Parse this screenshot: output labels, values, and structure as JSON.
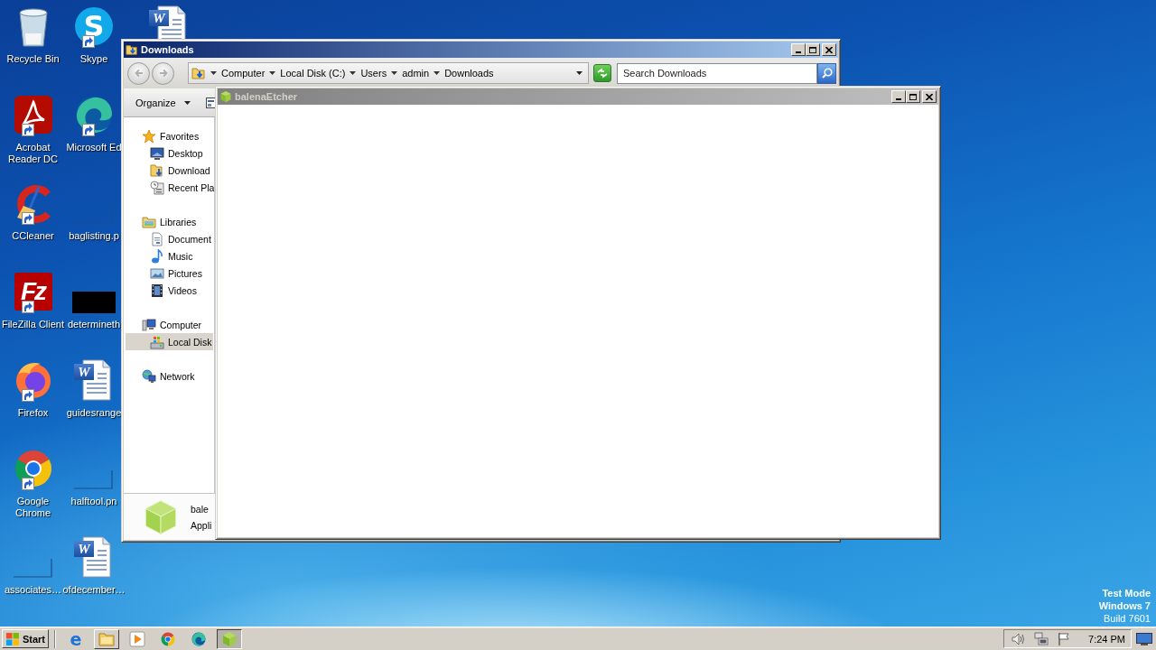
{
  "desktop": {
    "icons": [
      {
        "kind": "recycle-bin",
        "label": "Recycle Bin",
        "shortcut": false
      },
      {
        "kind": "acrobat",
        "label": "Acrobat Reader DC",
        "shortcut": true
      },
      {
        "kind": "ccleaner",
        "label": "CCleaner",
        "shortcut": true
      },
      {
        "kind": "filezilla",
        "label": "FileZilla Client",
        "shortcut": true,
        "glyph": "Fz"
      },
      {
        "kind": "firefox",
        "label": "Firefox",
        "shortcut": true
      },
      {
        "kind": "chrome",
        "label": "Google Chrome",
        "shortcut": true
      },
      {
        "kind": "thumbnail",
        "label": "associates…",
        "shortcut": false
      },
      {
        "kind": "skype",
        "label": "Skype",
        "shortcut": true,
        "glyph": "S"
      },
      {
        "kind": "edge",
        "label": "Microsoft Ed",
        "shortcut": true
      },
      {
        "kind": "thumbnail",
        "label": "baglisting.p",
        "shortcut": false
      },
      {
        "kind": "dark-thumbnail",
        "label": "determineth",
        "shortcut": false
      },
      {
        "kind": "word",
        "label": "guidesrange",
        "shortcut": false,
        "glyph": "W"
      },
      {
        "kind": "thumbnail",
        "label": "halftool.pn",
        "shortcut": false
      },
      {
        "kind": "word",
        "label": "ofdecember…",
        "shortcut": false,
        "glyph": "W"
      },
      {
        "kind": "word",
        "shortcut": false,
        "glyph": "W"
      }
    ]
  },
  "explorer": {
    "title": "Downloads",
    "crumbs": [
      "Computer",
      "Local Disk (C:)",
      "Users",
      "admin",
      "Downloads"
    ],
    "search": {
      "placeholder": "Search Downloads"
    },
    "organize": "Organize",
    "nav": [
      {
        "kind": "favorites",
        "label": "Favorites",
        "selected": false,
        "children": [
          {
            "kind": "desktop",
            "label": "Desktop",
            "selected": false
          },
          {
            "kind": "downloads",
            "label": "Download",
            "selected": false
          },
          {
            "kind": "recent",
            "label": "Recent Pla",
            "selected": false
          }
        ]
      },
      {
        "kind": "libraries",
        "label": "Libraries",
        "selected": false,
        "children": [
          {
            "kind": "documents",
            "label": "Document",
            "selected": false
          },
          {
            "kind": "music",
            "label": "Music",
            "selected": false
          },
          {
            "kind": "pictures",
            "label": "Pictures",
            "selected": false
          },
          {
            "kind": "videos",
            "label": "Videos",
            "selected": false
          }
        ]
      },
      {
        "kind": "computer",
        "label": "Computer",
        "selected": false,
        "children": [
          {
            "kind": "drive",
            "label": "Local Disk",
            "selected": true
          }
        ]
      },
      {
        "kind": "network",
        "label": "Network",
        "selected": false
      }
    ],
    "details": {
      "name": "bale",
      "type": "Appli"
    }
  },
  "etcher": {
    "title": "balenaEtcher"
  },
  "system_notice": [
    {
      "text": "Test Mode",
      "bold": true
    },
    {
      "text": "Windows 7",
      "bold": true
    },
    {
      "text": "Build 7601",
      "bold": false
    }
  ],
  "taskbar": {
    "start": "Start",
    "items": [
      {
        "kind": "ie",
        "glyph": "e",
        "open": false,
        "active": false
      },
      {
        "kind": "explorer",
        "open": true,
        "active": false
      },
      {
        "kind": "media-player",
        "open": false,
        "active": false
      },
      {
        "kind": "chrome",
        "open": false,
        "active": false
      },
      {
        "kind": "edge",
        "open": false,
        "active": false
      },
      {
        "kind": "etcher",
        "open": true,
        "active": true
      }
    ],
    "clock": "7:24 PM"
  }
}
